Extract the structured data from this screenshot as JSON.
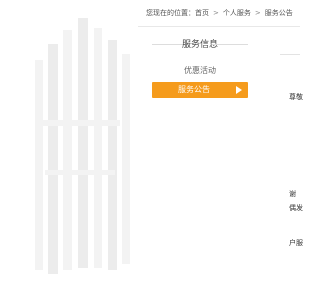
{
  "breadcrumb": {
    "prefix": "您现在的位置：",
    "items": [
      "首页",
      "个人服务",
      "服务公告"
    ],
    "separator": ">"
  },
  "sidebar": {
    "title": "服务信息",
    "items": [
      {
        "label": "优惠活动",
        "active": false
      },
      {
        "label": "服务公告",
        "active": true
      }
    ]
  },
  "content": {
    "fragments": [
      "尊敬",
      "谢",
      "偶发",
      "户服"
    ]
  },
  "colors": {
    "accent": "#f59b1c",
    "background": "#ffffff"
  }
}
